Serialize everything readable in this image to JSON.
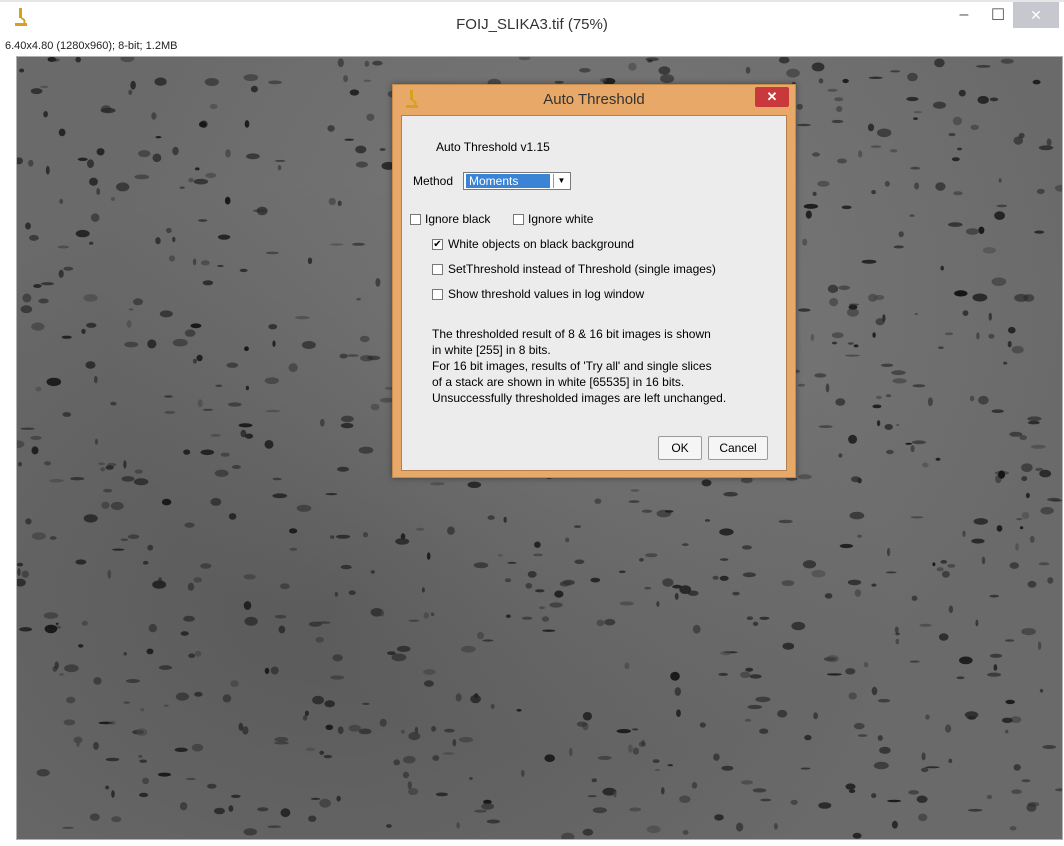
{
  "window": {
    "title": "FOIJ_SLIKA3.tif (75%)",
    "minimize_glyph": "–",
    "maximize_glyph": "☐",
    "close_glyph": "✕",
    "image_info": "6.40x4.80  (1280x960); 8-bit; 1.2MB",
    "icon": "microscope-icon"
  },
  "dialog": {
    "title": "Auto Threshold",
    "close_glyph": "✕",
    "icon": "microscope-icon",
    "version_label": "Auto Threshold v1.15",
    "method_label": "Method",
    "method_value": "Moments",
    "checkboxes": {
      "ignore_black": {
        "label": "Ignore black",
        "checked": false
      },
      "ignore_white": {
        "label": "Ignore white",
        "checked": false
      },
      "white_objects": {
        "label": "White objects on black background",
        "checked": true
      },
      "set_threshold": {
        "label": "SetThreshold instead of Threshold (single images)",
        "checked": false
      },
      "show_threshold": {
        "label": "Show threshold values in log window",
        "checked": false
      }
    },
    "notes": [
      "The thresholded result of 8 & 16 bit images is shown",
      "in white [255] in 8 bits.",
      "For 16 bit images, results of 'Try all' and single slices",
      "of a stack are shown in white [65535] in 16 bits.",
      "Unsuccessfully thresholded images are left unchanged."
    ],
    "ok_label": "OK",
    "cancel_label": "Cancel"
  },
  "colors": {
    "dialog_frame": "#e8a868",
    "selection": "#3a83d5",
    "close_red": "#c9393b"
  }
}
